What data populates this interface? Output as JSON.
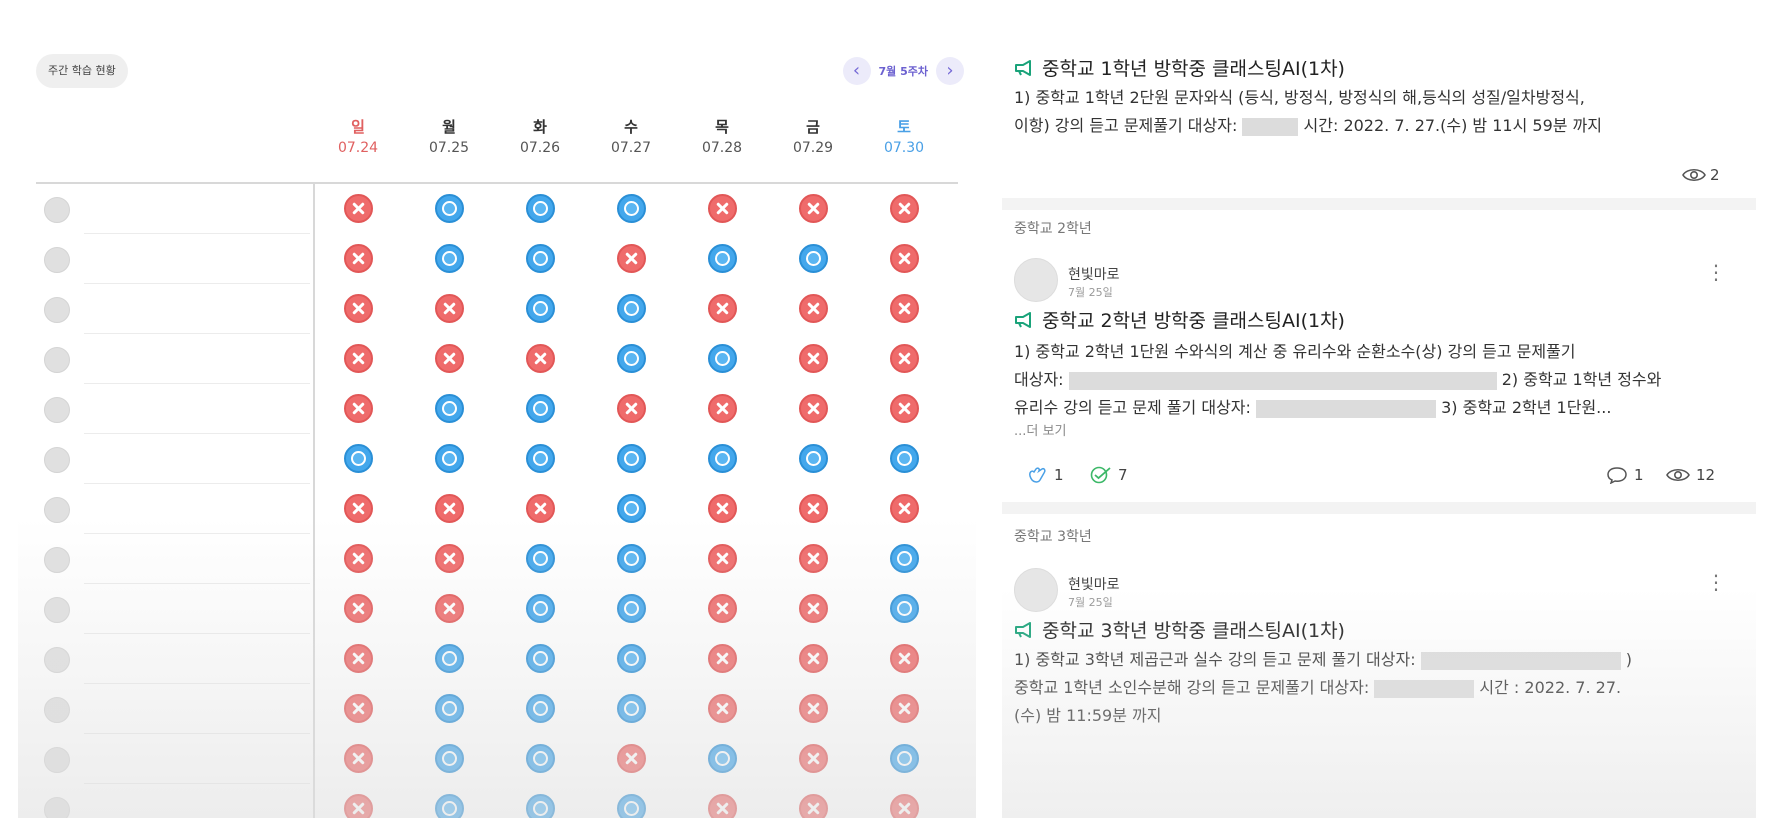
{
  "weekly": {
    "title": "주간 학습 현황",
    "week_label": "7월 5주차",
    "prev_icon": "chevron-left-icon",
    "next_icon": "chevron-right-icon",
    "days": [
      {
        "name": "일",
        "date": "07.24"
      },
      {
        "name": "월",
        "date": "07.25"
      },
      {
        "name": "화",
        "date": "07.26"
      },
      {
        "name": "수",
        "date": "07.27"
      },
      {
        "name": "목",
        "date": "07.28"
      },
      {
        "name": "금",
        "date": "07.29"
      },
      {
        "name": "토",
        "date": "07.30"
      }
    ],
    "colors": {
      "done": "#43a7ec",
      "missed": "#ef6b6b",
      "sunday": "#e06060",
      "saturday": "#4aa0e6"
    },
    "rows": [
      [
        "x",
        "o",
        "o",
        "o",
        "x",
        "x",
        "x"
      ],
      [
        "x",
        "o",
        "o",
        "x",
        "o",
        "o",
        "x"
      ],
      [
        "x",
        "x",
        "o",
        "o",
        "x",
        "x",
        "x"
      ],
      [
        "x",
        "x",
        "x",
        "o",
        "o",
        "x",
        "x"
      ],
      [
        "x",
        "o",
        "o",
        "x",
        "x",
        "x",
        "x"
      ],
      [
        "o",
        "o",
        "o",
        "o",
        "o",
        "o",
        "o"
      ],
      [
        "x",
        "x",
        "x",
        "o",
        "x",
        "x",
        "x"
      ],
      [
        "x",
        "x",
        "o",
        "o",
        "x",
        "x",
        "o"
      ],
      [
        "x",
        "x",
        "o",
        "o",
        "x",
        "x",
        "o"
      ],
      [
        "x",
        "o",
        "o",
        "o",
        "x",
        "x",
        "x"
      ],
      [
        "x",
        "o",
        "o",
        "o",
        "x",
        "x",
        "x"
      ],
      [
        "x",
        "o",
        "o",
        "x",
        "o",
        "x",
        "o"
      ],
      [
        "x",
        "o",
        "o",
        "o",
        "x",
        "x",
        "x"
      ]
    ]
  },
  "feed": {
    "post1": {
      "title": "중학교 1학년 방학중 클래스팅AI(1차)",
      "line1": "1) 중학교 1학년 2단원 문자와식 (등식, 방정식, 방정식의 해,등식의 성질/일차방정식,",
      "line2a": "이항) 강의 듣고 문제풀기 대상자:",
      "line2b": "시간: 2022. 7. 27.(수) 밤 11시 59분 까지",
      "views": "2"
    },
    "section2": "중학교 2학년",
    "post2": {
      "author": "현빛마로",
      "date": "7월 25일",
      "title": "중학교 2학년 방학중 클래스팅AI(1차)",
      "line1": "1) 중학교 2학년 1단원 수와식의 계산 중 유리수와 순환소수(상) 강의 듣고 문제풀기",
      "line2a": "대상자:",
      "line2b": "2) 중학교 1학년 정수와",
      "line3a": "유리수 강의 듣고 문제 풀기 대상자:",
      "line3b": "3) 중학교 2학년 1단원...",
      "more": "...더 보기",
      "likes": "1",
      "checks": "7",
      "comments": "1",
      "views": "12"
    },
    "section3": "중학교 3학년",
    "post3": {
      "author": "현빛마로",
      "date": "7월 25일",
      "title": "중학교 3학년 방학중 클래스팅AI(1차)",
      "line1a": "1) 중학교 3학년 제곱근과 실수 강의 듣고 문제 풀기 대상자:",
      "line1b": ")",
      "line2a": "중학교 1학년 소인수분해 강의 듣고 문제풀기 대상자:",
      "line2b": "시간 : 2022. 7. 27.",
      "line3": "(수) 밤 11:59분 까지"
    },
    "accent": "#1aa37a"
  }
}
